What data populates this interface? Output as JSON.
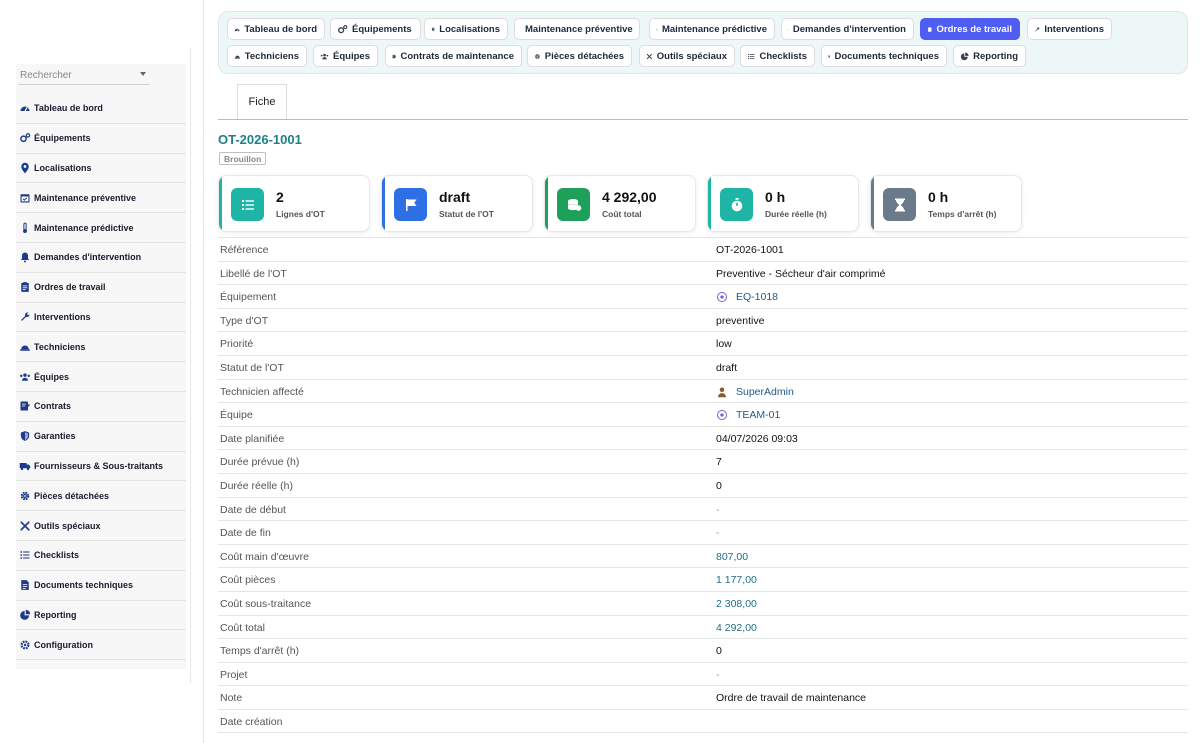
{
  "sidebar": {
    "search_placeholder": "Rechercher",
    "items": [
      {
        "label": "Tableau de bord",
        "icon": "dashboard-icon"
      },
      {
        "label": "Équipements",
        "icon": "gears-icon"
      },
      {
        "label": "Localisations",
        "icon": "map-pin-icon"
      },
      {
        "label": "Maintenance préventive",
        "icon": "calendar-check-icon"
      },
      {
        "label": "Maintenance prédictive",
        "icon": "thermometer-icon"
      },
      {
        "label": "Demandes d'intervention",
        "icon": "bell-icon"
      },
      {
        "label": "Ordres de travail",
        "icon": "clipboard-icon"
      },
      {
        "label": "Interventions",
        "icon": "wrench-icon"
      },
      {
        "label": "Techniciens",
        "icon": "hard-hat-icon"
      },
      {
        "label": "Équipes",
        "icon": "users-icon"
      },
      {
        "label": "Contrats",
        "icon": "contract-icon"
      },
      {
        "label": "Garanties",
        "icon": "shield-icon"
      },
      {
        "label": "Fournisseurs & Sous-traitants",
        "icon": "truck-icon"
      },
      {
        "label": "Pièces détachées",
        "icon": "cog-icon"
      },
      {
        "label": "Outils spéciaux",
        "icon": "tools-icon"
      },
      {
        "label": "Checklists",
        "icon": "list-icon"
      },
      {
        "label": "Documents techniques",
        "icon": "document-icon"
      },
      {
        "label": "Reporting",
        "icon": "pie-chart-icon"
      },
      {
        "label": "Configuration",
        "icon": "settings-icon"
      }
    ]
  },
  "topnav": {
    "tabs": [
      {
        "label": "Tableau de bord",
        "icon": "dashboard-icon",
        "active": false
      },
      {
        "label": "Équipements",
        "icon": "gears-icon",
        "active": false
      },
      {
        "label": "Localisations",
        "icon": "map-pin-icon",
        "active": false
      },
      {
        "label": "Maintenance préventive",
        "icon": "calendar-check-icon",
        "active": false
      },
      {
        "label": "Maintenance prédictive",
        "icon": "thermometer-icon",
        "active": false
      },
      {
        "label": "Demandes d'intervention",
        "icon": "bell-icon",
        "active": false
      },
      {
        "label": "Ordres de travail",
        "icon": "clipboard-icon",
        "active": true
      },
      {
        "label": "Interventions",
        "icon": "wrench-icon",
        "active": false
      },
      {
        "label": "Techniciens",
        "icon": "hard-hat-icon",
        "active": false
      },
      {
        "label": "Équipes",
        "icon": "users-icon",
        "active": false
      },
      {
        "label": "Contrats de maintenance",
        "icon": "contract-icon",
        "active": false
      },
      {
        "label": "Pièces détachées",
        "icon": "cog-icon",
        "active": false
      },
      {
        "label": "Outils spéciaux",
        "icon": "tools-icon",
        "active": false
      },
      {
        "label": "Checklists",
        "icon": "list-icon",
        "active": false
      },
      {
        "label": "Documents techniques",
        "icon": "document-icon",
        "active": false
      },
      {
        "label": "Reporting",
        "icon": "pie-chart-icon",
        "active": false
      }
    ]
  },
  "page": {
    "subtab": "Fiche",
    "reference": "OT-2026-1001",
    "status_badge": "Brouillon"
  },
  "kpis": [
    {
      "value": "2",
      "caption": "Lignes d'OT",
      "color": "#1fb5a6",
      "icon": "list-icon"
    },
    {
      "value": "draft",
      "caption": "Statut de l'OT",
      "color": "#2f6fe6",
      "icon": "flag-icon"
    },
    {
      "value": "4 292,00",
      "caption": "Coût total",
      "color": "#1fa05a",
      "icon": "coins-icon"
    },
    {
      "value": "0 h",
      "caption": "Durée réelle (h)",
      "color": "#1fb5a6",
      "icon": "stopwatch-icon"
    },
    {
      "value": "0 h",
      "caption": "Temps d'arrêt (h)",
      "color": "#6b7a8a",
      "icon": "hourglass-icon"
    }
  ],
  "fields": [
    {
      "label": "Référence",
      "value": "OT-2026-1001",
      "kind": "text"
    },
    {
      "label": "Libellé de l'OT",
      "value": "Preventive - Sécheur d'air comprimé",
      "kind": "text"
    },
    {
      "label": "Équipement",
      "value": "EQ-1018",
      "kind": "link",
      "icon": "target-icon"
    },
    {
      "label": "Type d'OT",
      "value": "preventive",
      "kind": "text"
    },
    {
      "label": "Priorité",
      "value": "low",
      "kind": "text"
    },
    {
      "label": "Statut de l'OT",
      "value": "draft",
      "kind": "text"
    },
    {
      "label": "Technicien affecté",
      "value": "SuperAdmin",
      "kind": "link",
      "icon": "user-icon"
    },
    {
      "label": "Équipe",
      "value": "TEAM-01",
      "kind": "link",
      "icon": "target-icon"
    },
    {
      "label": "Date planifiée",
      "value": "04/07/2026 09:03",
      "kind": "text"
    },
    {
      "label": "Durée prévue (h)",
      "value": "7",
      "kind": "text"
    },
    {
      "label": "Durée réelle (h)",
      "value": "0",
      "kind": "text"
    },
    {
      "label": "Date de début",
      "value": "-",
      "kind": "muted"
    },
    {
      "label": "Date de fin",
      "value": "-",
      "kind": "muted"
    },
    {
      "label": "Coût main d'œuvre",
      "value": "807,00",
      "kind": "money"
    },
    {
      "label": "Coût pièces",
      "value": "1 177,00",
      "kind": "money"
    },
    {
      "label": "Coût sous-traitance",
      "value": "2 308,00",
      "kind": "money"
    },
    {
      "label": "Coût total",
      "value": "4 292,00",
      "kind": "money"
    },
    {
      "label": "Temps d'arrêt (h)",
      "value": "0",
      "kind": "text"
    },
    {
      "label": "Projet",
      "value": "-",
      "kind": "muted"
    },
    {
      "label": "Note",
      "value": "Ordre de travail de maintenance",
      "kind": "text"
    },
    {
      "label": "Date création",
      "value": "",
      "kind": "text"
    }
  ]
}
